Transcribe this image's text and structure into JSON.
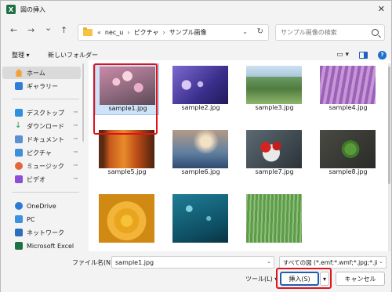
{
  "window": {
    "title": "図の挿入",
    "app_icon": "excel-icon",
    "close": "✕"
  },
  "nav": {
    "back": "←",
    "forward": "→",
    "recent": "⌄",
    "up": "↑",
    "path": [
      "nec_u",
      "ピクチャ",
      "サンプル画像"
    ],
    "path_prefix": "«",
    "refresh": "↻",
    "search_placeholder": "サンプル画像の検索"
  },
  "toolbar": {
    "organize": "整理 ▾",
    "new_folder": "新しいフォルダー",
    "view": "▭ ▾"
  },
  "sidebar": {
    "items": [
      {
        "label": "ホーム",
        "icon": "home-icon",
        "selected": true
      },
      {
        "label": "ギャラリー",
        "icon": "gallery-icon"
      },
      {
        "label": "デスクトップ",
        "icon": "desktop-icon",
        "pinned": true
      },
      {
        "label": "ダウンロード",
        "icon": "download-icon",
        "pinned": true
      },
      {
        "label": "ドキュメント",
        "icon": "documents-icon",
        "pinned": true
      },
      {
        "label": "ピクチャ",
        "icon": "pictures-icon",
        "pinned": true
      },
      {
        "label": "ミュージック",
        "icon": "music-icon",
        "pinned": true
      },
      {
        "label": "ビデオ",
        "icon": "videos-icon",
        "pinned": true
      },
      {
        "label": "OneDrive",
        "icon": "onedrive-icon"
      },
      {
        "label": "PC",
        "icon": "pc-icon"
      },
      {
        "label": "ネットワーク",
        "icon": "network-icon"
      },
      {
        "label": "Microsoft Excel",
        "icon": "excel-icon"
      }
    ],
    "pin_glyph": "📌"
  },
  "files": [
    {
      "name": "sample1.jpg",
      "selected": true
    },
    {
      "name": "sample2.jpg"
    },
    {
      "name": "sample3.jpg"
    },
    {
      "name": "sample4.jpg"
    },
    {
      "name": "sample5.jpg"
    },
    {
      "name": "sample6.jpg"
    },
    {
      "name": "sample7.jpg"
    },
    {
      "name": "sample8.jpg"
    },
    {
      "name": ""
    },
    {
      "name": ""
    },
    {
      "name": ""
    }
  ],
  "bottom": {
    "filename_label": "ファイル名(N):",
    "filename_value": "sample1.jpg",
    "filetype_value": "すべての図 (*.emf;*.wmf;*.jpg;*.ji",
    "tools": "ツール(L) ▾",
    "insert": "挿入(S)",
    "insert_dd": "▾",
    "cancel": "キャンセル"
  },
  "colors": {
    "accent": "#1a5fb4",
    "highlight": "#e0121b",
    "selection": "#cfe3f8"
  }
}
